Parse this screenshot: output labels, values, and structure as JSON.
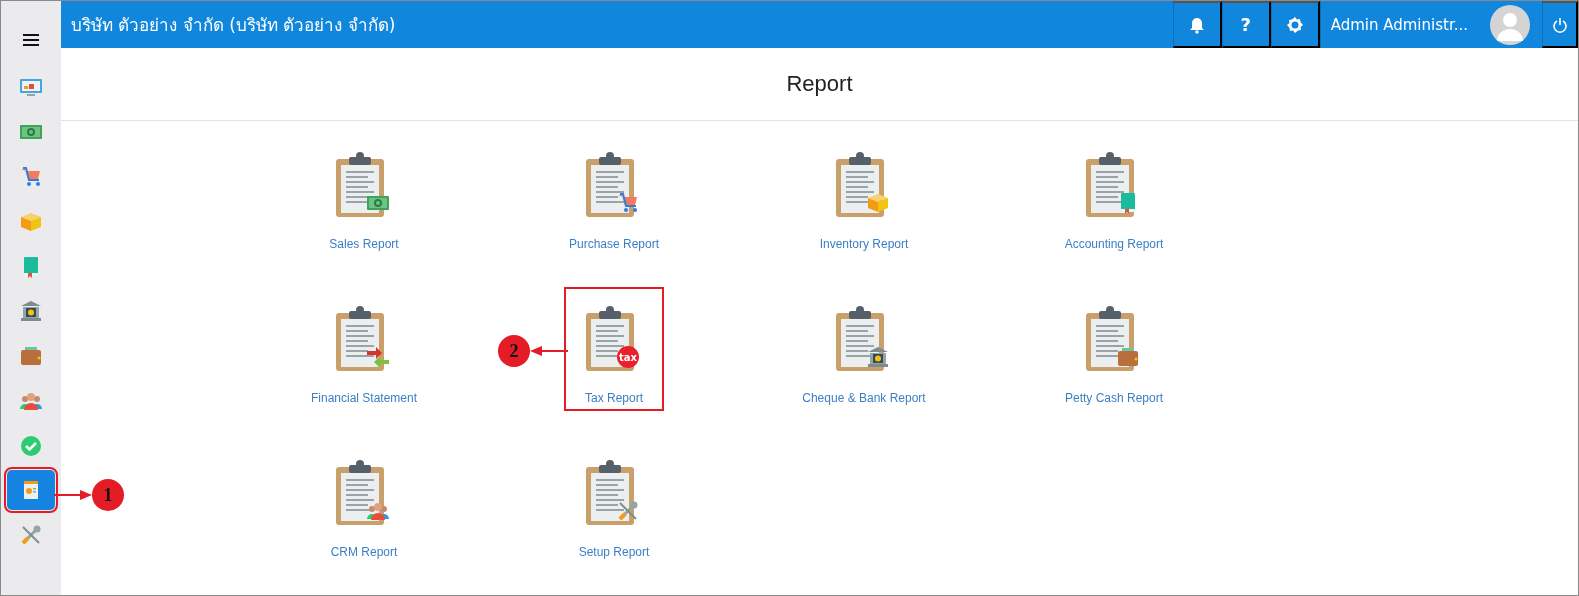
{
  "sidebar": {
    "items": [
      {
        "kind": "dashboard",
        "selected": false,
        "highlighted": false
      },
      {
        "kind": "money",
        "selected": false,
        "highlighted": false
      },
      {
        "kind": "cart",
        "selected": false,
        "highlighted": false
      },
      {
        "kind": "box",
        "selected": false,
        "highlighted": false
      },
      {
        "kind": "book",
        "selected": false,
        "highlighted": false
      },
      {
        "kind": "bank",
        "selected": false,
        "highlighted": false
      },
      {
        "kind": "wallet",
        "selected": false,
        "highlighted": false
      },
      {
        "kind": "people",
        "selected": false,
        "highlighted": false
      },
      {
        "kind": "check",
        "selected": false,
        "highlighted": false
      },
      {
        "kind": "report",
        "selected": true,
        "highlighted": true
      },
      {
        "kind": "tools",
        "selected": false,
        "highlighted": false
      }
    ]
  },
  "top_bar": {
    "title": "บริษัท ตัวอย่าง จำกัด (บริษัท ตัวอย่าง จำกัด)",
    "help": "?",
    "user": "Admin Administr..."
  },
  "page": {
    "title": "Report"
  },
  "tiles": [
    {
      "label": "Sales Report",
      "kind": "money",
      "highlighted": false
    },
    {
      "label": "Purchase Report",
      "kind": "cart",
      "highlighted": false
    },
    {
      "label": "Inventory Report",
      "kind": "box",
      "highlighted": false
    },
    {
      "label": "Accounting Report",
      "kind": "book",
      "highlighted": false
    },
    {
      "label": "Financial Statement",
      "kind": "exchange",
      "highlighted": false
    },
    {
      "label": "Tax Report",
      "kind": "tax",
      "badge_text": "tax",
      "highlighted": true
    },
    {
      "label": "Cheque & Bank Report",
      "kind": "bank",
      "highlighted": false
    },
    {
      "label": "Petty Cash Report",
      "kind": "wallet",
      "highlighted": false
    },
    {
      "label": "CRM Report",
      "kind": "people",
      "highlighted": false
    },
    {
      "label": "Setup Report",
      "kind": "tools",
      "highlighted": false
    }
  ],
  "callouts": [
    {
      "number": "1"
    },
    {
      "number": "2"
    }
  ]
}
